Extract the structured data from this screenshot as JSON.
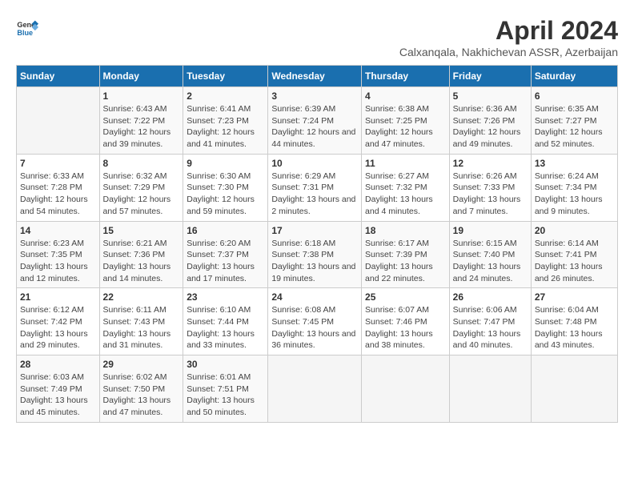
{
  "logo": {
    "line1": "General",
    "line2": "Blue"
  },
  "title": "April 2024",
  "subtitle": "Calxanqala, Nakhichevan ASSR, Azerbaijan",
  "headers": [
    "Sunday",
    "Monday",
    "Tuesday",
    "Wednesday",
    "Thursday",
    "Friday",
    "Saturday"
  ],
  "weeks": [
    [
      {
        "day": "",
        "sunrise": "",
        "sunset": "",
        "daylight": ""
      },
      {
        "day": "1",
        "sunrise": "Sunrise: 6:43 AM",
        "sunset": "Sunset: 7:22 PM",
        "daylight": "Daylight: 12 hours and 39 minutes."
      },
      {
        "day": "2",
        "sunrise": "Sunrise: 6:41 AM",
        "sunset": "Sunset: 7:23 PM",
        "daylight": "Daylight: 12 hours and 41 minutes."
      },
      {
        "day": "3",
        "sunrise": "Sunrise: 6:39 AM",
        "sunset": "Sunset: 7:24 PM",
        "daylight": "Daylight: 12 hours and 44 minutes."
      },
      {
        "day": "4",
        "sunrise": "Sunrise: 6:38 AM",
        "sunset": "Sunset: 7:25 PM",
        "daylight": "Daylight: 12 hours and 47 minutes."
      },
      {
        "day": "5",
        "sunrise": "Sunrise: 6:36 AM",
        "sunset": "Sunset: 7:26 PM",
        "daylight": "Daylight: 12 hours and 49 minutes."
      },
      {
        "day": "6",
        "sunrise": "Sunrise: 6:35 AM",
        "sunset": "Sunset: 7:27 PM",
        "daylight": "Daylight: 12 hours and 52 minutes."
      }
    ],
    [
      {
        "day": "7",
        "sunrise": "Sunrise: 6:33 AM",
        "sunset": "Sunset: 7:28 PM",
        "daylight": "Daylight: 12 hours and 54 minutes."
      },
      {
        "day": "8",
        "sunrise": "Sunrise: 6:32 AM",
        "sunset": "Sunset: 7:29 PM",
        "daylight": "Daylight: 12 hours and 57 minutes."
      },
      {
        "day": "9",
        "sunrise": "Sunrise: 6:30 AM",
        "sunset": "Sunset: 7:30 PM",
        "daylight": "Daylight: 12 hours and 59 minutes."
      },
      {
        "day": "10",
        "sunrise": "Sunrise: 6:29 AM",
        "sunset": "Sunset: 7:31 PM",
        "daylight": "Daylight: 13 hours and 2 minutes."
      },
      {
        "day": "11",
        "sunrise": "Sunrise: 6:27 AM",
        "sunset": "Sunset: 7:32 PM",
        "daylight": "Daylight: 13 hours and 4 minutes."
      },
      {
        "day": "12",
        "sunrise": "Sunrise: 6:26 AM",
        "sunset": "Sunset: 7:33 PM",
        "daylight": "Daylight: 13 hours and 7 minutes."
      },
      {
        "day": "13",
        "sunrise": "Sunrise: 6:24 AM",
        "sunset": "Sunset: 7:34 PM",
        "daylight": "Daylight: 13 hours and 9 minutes."
      }
    ],
    [
      {
        "day": "14",
        "sunrise": "Sunrise: 6:23 AM",
        "sunset": "Sunset: 7:35 PM",
        "daylight": "Daylight: 13 hours and 12 minutes."
      },
      {
        "day": "15",
        "sunrise": "Sunrise: 6:21 AM",
        "sunset": "Sunset: 7:36 PM",
        "daylight": "Daylight: 13 hours and 14 minutes."
      },
      {
        "day": "16",
        "sunrise": "Sunrise: 6:20 AM",
        "sunset": "Sunset: 7:37 PM",
        "daylight": "Daylight: 13 hours and 17 minutes."
      },
      {
        "day": "17",
        "sunrise": "Sunrise: 6:18 AM",
        "sunset": "Sunset: 7:38 PM",
        "daylight": "Daylight: 13 hours and 19 minutes."
      },
      {
        "day": "18",
        "sunrise": "Sunrise: 6:17 AM",
        "sunset": "Sunset: 7:39 PM",
        "daylight": "Daylight: 13 hours and 22 minutes."
      },
      {
        "day": "19",
        "sunrise": "Sunrise: 6:15 AM",
        "sunset": "Sunset: 7:40 PM",
        "daylight": "Daylight: 13 hours and 24 minutes."
      },
      {
        "day": "20",
        "sunrise": "Sunrise: 6:14 AM",
        "sunset": "Sunset: 7:41 PM",
        "daylight": "Daylight: 13 hours and 26 minutes."
      }
    ],
    [
      {
        "day": "21",
        "sunrise": "Sunrise: 6:12 AM",
        "sunset": "Sunset: 7:42 PM",
        "daylight": "Daylight: 13 hours and 29 minutes."
      },
      {
        "day": "22",
        "sunrise": "Sunrise: 6:11 AM",
        "sunset": "Sunset: 7:43 PM",
        "daylight": "Daylight: 13 hours and 31 minutes."
      },
      {
        "day": "23",
        "sunrise": "Sunrise: 6:10 AM",
        "sunset": "Sunset: 7:44 PM",
        "daylight": "Daylight: 13 hours and 33 minutes."
      },
      {
        "day": "24",
        "sunrise": "Sunrise: 6:08 AM",
        "sunset": "Sunset: 7:45 PM",
        "daylight": "Daylight: 13 hours and 36 minutes."
      },
      {
        "day": "25",
        "sunrise": "Sunrise: 6:07 AM",
        "sunset": "Sunset: 7:46 PM",
        "daylight": "Daylight: 13 hours and 38 minutes."
      },
      {
        "day": "26",
        "sunrise": "Sunrise: 6:06 AM",
        "sunset": "Sunset: 7:47 PM",
        "daylight": "Daylight: 13 hours and 40 minutes."
      },
      {
        "day": "27",
        "sunrise": "Sunrise: 6:04 AM",
        "sunset": "Sunset: 7:48 PM",
        "daylight": "Daylight: 13 hours and 43 minutes."
      }
    ],
    [
      {
        "day": "28",
        "sunrise": "Sunrise: 6:03 AM",
        "sunset": "Sunset: 7:49 PM",
        "daylight": "Daylight: 13 hours and 45 minutes."
      },
      {
        "day": "29",
        "sunrise": "Sunrise: 6:02 AM",
        "sunset": "Sunset: 7:50 PM",
        "daylight": "Daylight: 13 hours and 47 minutes."
      },
      {
        "day": "30",
        "sunrise": "Sunrise: 6:01 AM",
        "sunset": "Sunset: 7:51 PM",
        "daylight": "Daylight: 13 hours and 50 minutes."
      },
      {
        "day": "",
        "sunrise": "",
        "sunset": "",
        "daylight": ""
      },
      {
        "day": "",
        "sunrise": "",
        "sunset": "",
        "daylight": ""
      },
      {
        "day": "",
        "sunrise": "",
        "sunset": "",
        "daylight": ""
      },
      {
        "day": "",
        "sunrise": "",
        "sunset": "",
        "daylight": ""
      }
    ]
  ]
}
